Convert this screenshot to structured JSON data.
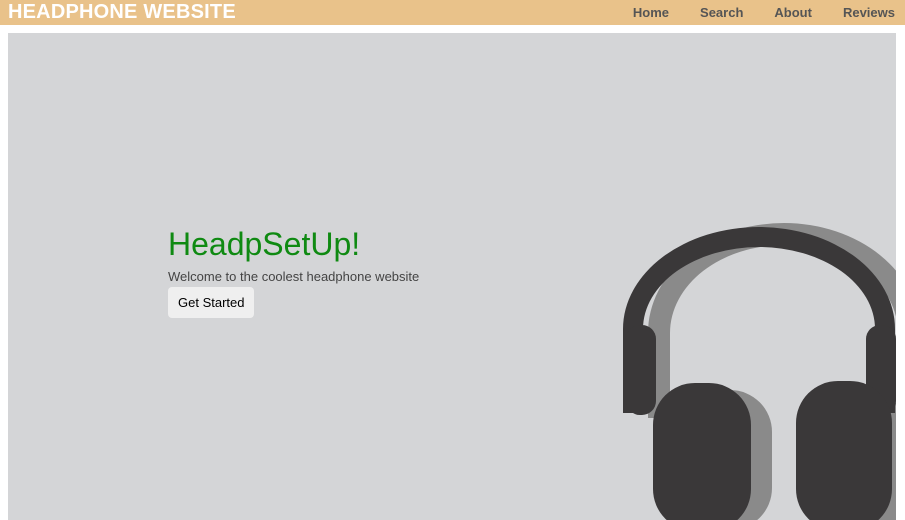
{
  "header": {
    "brand": "HEADPHONE WEBSITE",
    "nav": [
      "Home",
      "Search",
      "About",
      "Reviews"
    ]
  },
  "hero": {
    "title": "HeadpSetUp!",
    "tagline": "Welcome to the coolest headphone website",
    "button_label": "Get Started",
    "image_icon": "headphones-icon"
  },
  "colors": {
    "header_bg": "#e9c28a",
    "brand_text": "#ffffff",
    "nav_text": "#555555",
    "hero_bg": "#d4d5d7",
    "title": "#0f8a12",
    "headphone_dark": "#3a3839",
    "headphone_shadow": "#8a8a8a"
  }
}
